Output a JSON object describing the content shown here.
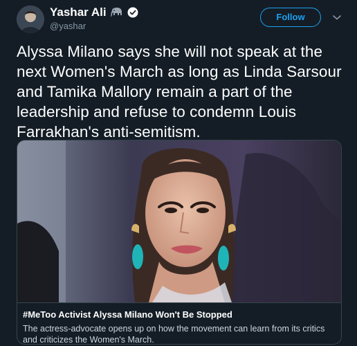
{
  "tweet": {
    "author_name": "Yashar Ali",
    "author_handle": "@yashar",
    "follow_label": "Follow",
    "text": "Alyssa Milano says she will not speak at the next Women's March as long as Linda Sarsour and Tamika Mallory remain a part of the leadership and refuse to condemn Louis Farrakhan's anti-semitism."
  },
  "card": {
    "title": "#MeToo Activist Alyssa Milano Won't Be Stopped",
    "description": "The actress-advocate opens up on how the movement can learn from its critics and criticizes the Women's March."
  },
  "icons": {
    "badge": "elephant-icon",
    "verified": "verified-icon",
    "menu": "chevron-down-icon"
  },
  "colors": {
    "background": "#141d26",
    "accent": "#1da1f2",
    "secondary_text": "#8899a6",
    "border": "#38444d"
  }
}
